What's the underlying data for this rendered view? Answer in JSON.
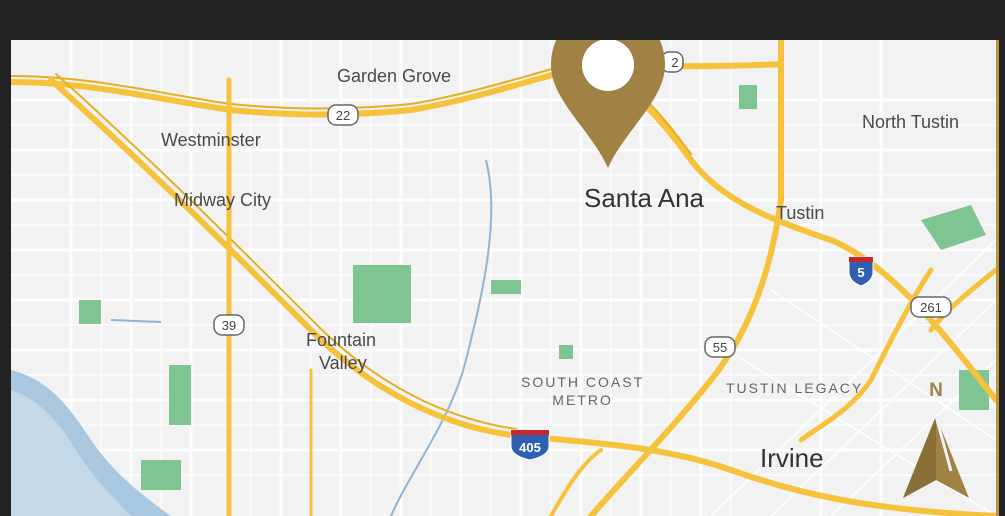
{
  "places": {
    "garden_grove": "Garden Grove",
    "westminster": "Westminster",
    "midway_city": "Midway City",
    "fountain_valley_1": "Fountain",
    "fountain_valley_2": "Valley",
    "santa_ana": "Santa Ana",
    "tustin": "Tustin",
    "north_tustin": "North Tustin",
    "south_coast_metro_1": "SOUTH COAST",
    "south_coast_metro_2": "METRO",
    "tustin_legacy": "TUSTIN LEGACY",
    "irvine": "Irvine"
  },
  "shields": {
    "sr22": "22",
    "sr22_partial": "2",
    "sr39": "39",
    "sr55": "55",
    "sr261": "261",
    "i5": "5",
    "i405": "405"
  },
  "compass": {
    "label": "N",
    "icon": "north-arrow-icon"
  },
  "marker": {
    "icon": "location-pin-icon"
  },
  "colors": {
    "frame": "#222222",
    "gold": "#a08245",
    "map_bg": "#f2f2f2",
    "road": "#f6c23c",
    "park": "#7fc591",
    "water": "#a9c8df"
  }
}
